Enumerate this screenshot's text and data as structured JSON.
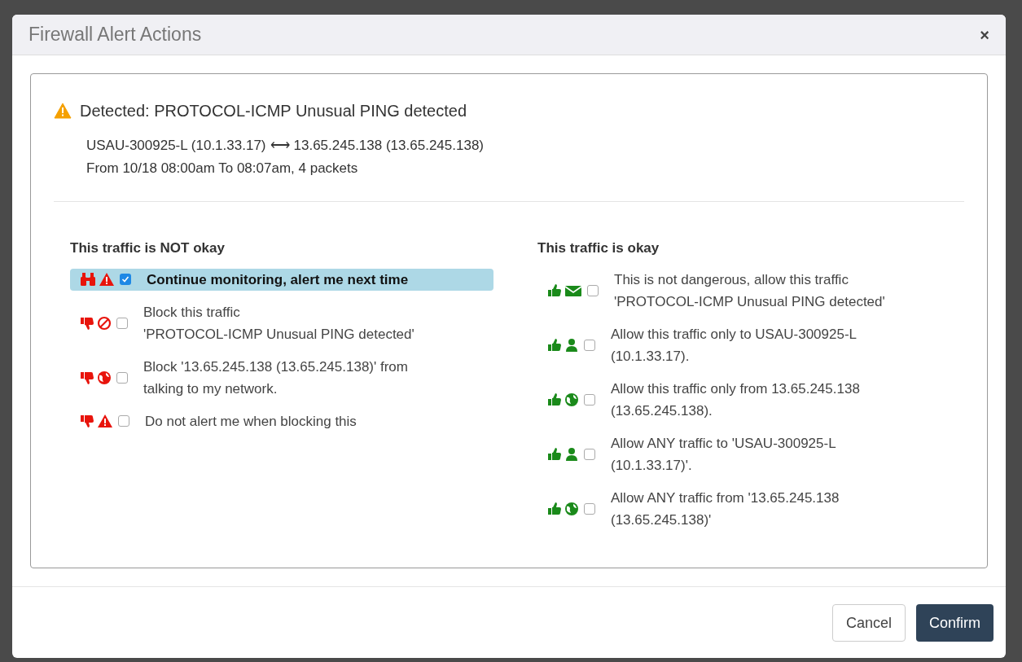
{
  "dialog": {
    "title": "Firewall Alert Actions",
    "close": "×"
  },
  "alert": {
    "heading": "Detected: PROTOCOL-ICMP Unusual PING detected",
    "source": "USAU-300925-L (10.1.33.17)",
    "arrow": "⟷",
    "destination": "13.65.245.138 (13.65.245.138)",
    "time": "From 10/18 08:00am To 08:07am, 4 packets"
  },
  "columns": [
    {
      "kind": "bad",
      "heading": "This traffic is NOT okay",
      "options": [
        {
          "icons": [
            {
              "kind": "binoculars"
            },
            {
              "kind": "warning"
            }
          ],
          "label": "Continue monitoring, alert me next time",
          "checked": true
        },
        {
          "icons": [
            {
              "kind": "thumbsdown"
            },
            {
              "kind": "ban"
            }
          ],
          "label": "Block this traffic\n'PROTOCOL-ICMP Unusual PING detected'",
          "checked": false
        },
        {
          "icons": [
            {
              "kind": "thumbsdown"
            },
            {
              "kind": "globe"
            }
          ],
          "label": "Block '13.65.245.138 (13.65.245.138)' from\ntalking to my network.",
          "checked": false
        },
        {
          "icons": [
            {
              "kind": "thumbsdown"
            },
            {
              "kind": "warning"
            }
          ],
          "label": "Do not alert me when blocking this",
          "checked": false
        }
      ]
    },
    {
      "kind": "good",
      "heading": "This traffic is okay",
      "options": [
        {
          "icons": [
            {
              "kind": "thumbsup"
            },
            {
              "kind": "envelope"
            }
          ],
          "label": "This is not dangerous, allow this traffic\n'PROTOCOL-ICMP Unusual PING detected'",
          "checked": false
        },
        {
          "icons": [
            {
              "kind": "thumbsup"
            },
            {
              "kind": "user"
            }
          ],
          "label": "Allow this traffic only to USAU-300925-L\n(10.1.33.17).",
          "checked": false
        },
        {
          "icons": [
            {
              "kind": "thumbsup"
            },
            {
              "kind": "globe"
            }
          ],
          "label": "Allow this traffic only from 13.65.245.138\n(13.65.245.138).",
          "checked": false
        },
        {
          "icons": [
            {
              "kind": "thumbsup"
            },
            {
              "kind": "user"
            }
          ],
          "label": "Allow ANY traffic to 'USAU-300925-L\n(10.1.33.17)'.",
          "checked": false
        },
        {
          "icons": [
            {
              "kind": "thumbsup"
            },
            {
              "kind": "globe"
            }
          ],
          "label": "Allow ANY traffic from '13.65.245.138\n(13.65.245.138)'",
          "checked": false
        }
      ]
    }
  ],
  "buttons": [
    {
      "kind": "secondary",
      "label": "Cancel"
    },
    {
      "kind": "primary",
      "label": "Confirm"
    }
  ]
}
